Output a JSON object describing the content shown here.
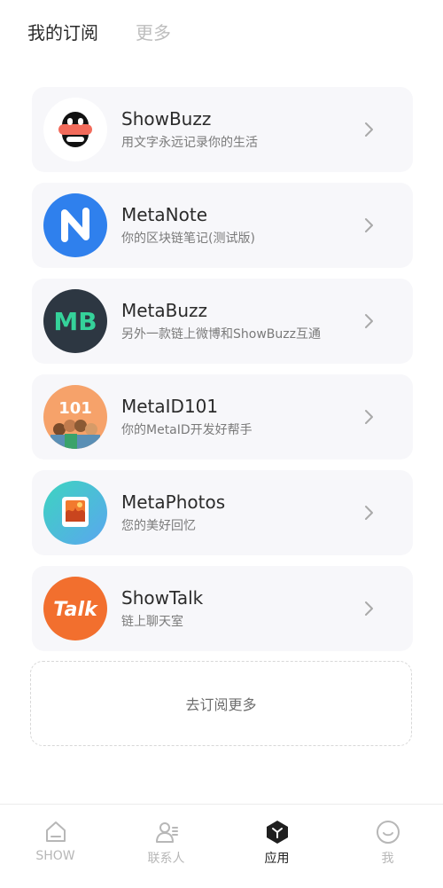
{
  "header": {
    "tabs": [
      {
        "label": "我的订阅",
        "active": true
      },
      {
        "label": "更多",
        "active": false
      }
    ]
  },
  "apps": [
    {
      "name": "ShowBuzz",
      "desc": "用文字永远记录你的生活",
      "icon": "showbuzz-logo"
    },
    {
      "name": "MetaNote",
      "desc": "你的区块链笔记(测试版)",
      "icon": "metanote-logo"
    },
    {
      "name": "MetaBuzz",
      "desc": "另外一款链上微博和ShowBuzz互通",
      "icon": "metabuzz-logo",
      "icon_text": "MB"
    },
    {
      "name": "MetaID101",
      "desc": "你的MetaID开发好帮手",
      "icon": "metaid101-logo",
      "icon_text": "101"
    },
    {
      "name": "MetaPhotos",
      "desc": "您的美好回忆",
      "icon": "metaphotos-logo"
    },
    {
      "name": "ShowTalk",
      "desc": "链上聊天室",
      "icon": "showtalk-logo",
      "icon_text": "Talk"
    }
  ],
  "subscribe_more": "去订阅更多",
  "bottom_nav": [
    {
      "label": "SHOW",
      "icon": "home-icon",
      "active": false
    },
    {
      "label": "联系人",
      "icon": "contacts-icon",
      "active": false
    },
    {
      "label": "应用",
      "icon": "apps-icon",
      "active": true
    },
    {
      "label": "我",
      "icon": "profile-smile-icon",
      "active": false
    }
  ],
  "colors": {
    "card_bg": "#f7f7fa",
    "metanote_blue": "#2f80ed",
    "metabuzz_dark": "#2d3742",
    "metabuzz_green": "#35d29a",
    "metaid_orange": "#f6a26a",
    "showtalk_orange": "#f26f2e"
  }
}
